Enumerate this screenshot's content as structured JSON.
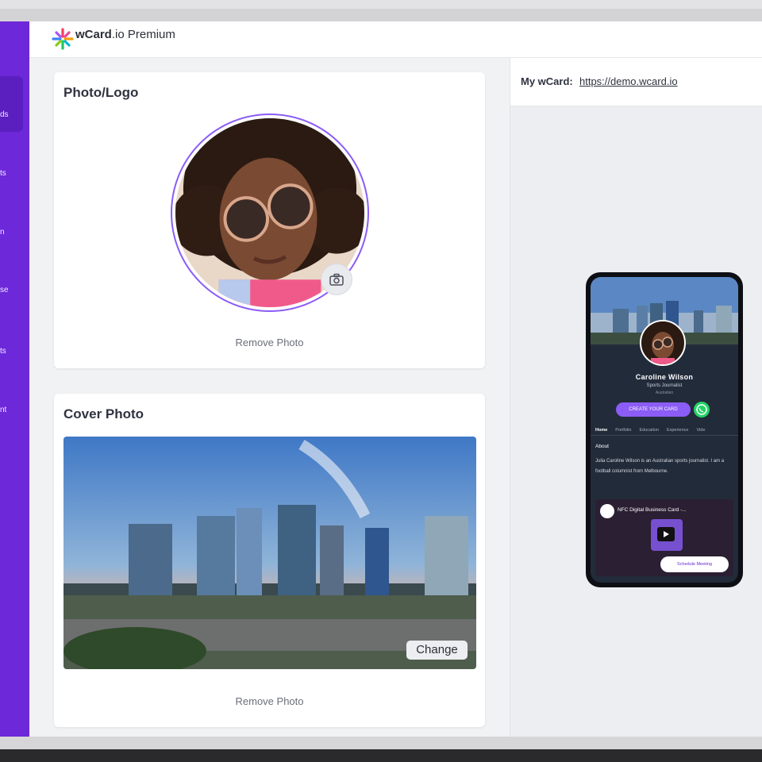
{
  "app": {
    "brand_bold": "wCard",
    "brand_rest": ".io Premium"
  },
  "sidebar": {
    "items": [
      {
        "label": "ds"
      },
      {
        "label": "ts"
      },
      {
        "label": "n"
      },
      {
        "label": "se"
      },
      {
        "label": "ts"
      },
      {
        "label": "nt"
      }
    ]
  },
  "photo_logo": {
    "title": "Photo/Logo",
    "remove_label": "Remove Photo"
  },
  "cover_photo": {
    "title": "Cover Photo",
    "change_label": "Change",
    "remove_label": "Remove Photo"
  },
  "my_wcard": {
    "label": "My wCard:",
    "url": "https://demo.wcard.io"
  },
  "preview": {
    "name": "Caroline Wilson",
    "title": "Sports Journalist",
    "location": "Australian",
    "cta": "CREATE YOUR CARD",
    "tabs": [
      "Home",
      "Portfolio",
      "Education",
      "Experience",
      "Vide"
    ],
    "about_heading": "About",
    "bio": "Julia Caroline Wilson is an Australian sports journalist. I am a football columnist from Melbourne.",
    "video_title": "NFC Digital Business Card -...",
    "schedule": "Schedule Meeting"
  },
  "colors": {
    "accent": "#6d28d9",
    "accent_light": "#8b5cf6",
    "whatsapp": "#25d366"
  }
}
